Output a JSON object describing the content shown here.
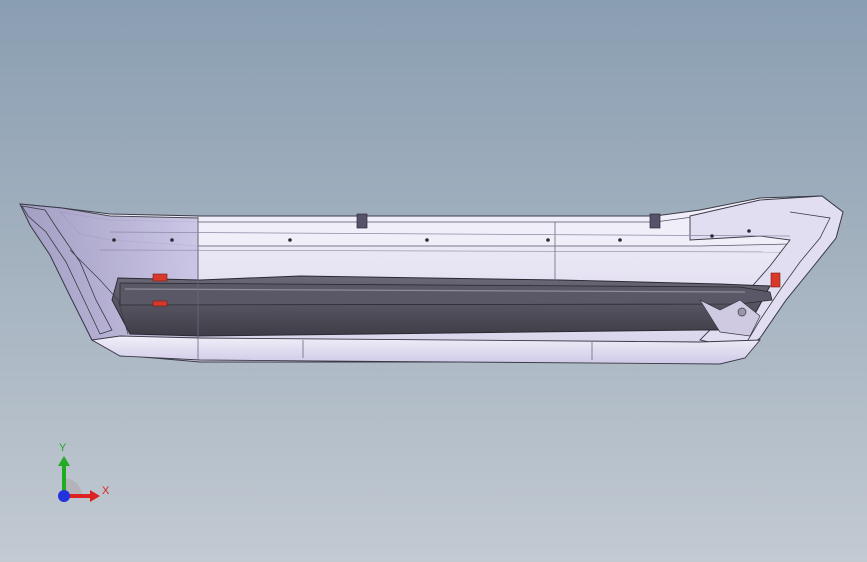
{
  "viewport": {
    "background_top": "#8a9eb2",
    "background_bottom": "#c2cad2",
    "model": {
      "name": "bumper-part",
      "body_color": "#d9d3ef",
      "shadow_color": "#4a4856",
      "accent_color": "#d8392b"
    }
  },
  "triad": {
    "y_label": "Y",
    "x_label": "X",
    "y_color": "#22aa22",
    "x_color": "#dd2222",
    "z_color": "#2233dd"
  }
}
